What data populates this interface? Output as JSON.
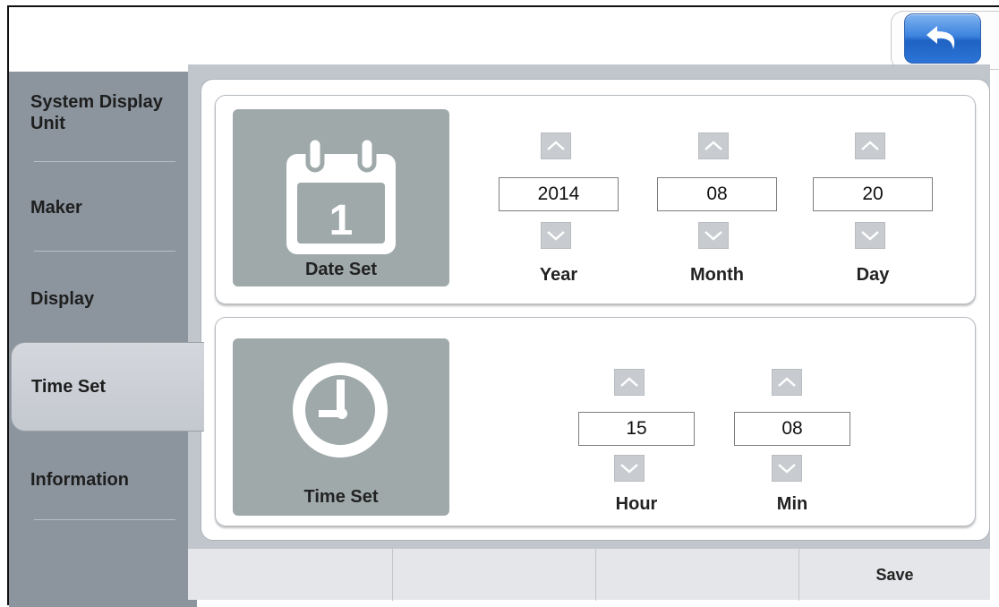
{
  "sidebar": {
    "items": [
      {
        "label": "System Display Unit"
      },
      {
        "label": "Maker"
      },
      {
        "label": "Display"
      },
      {
        "label": "Time Set"
      },
      {
        "label": "Information"
      }
    ]
  },
  "date_set": {
    "label": "Date Set",
    "day_number": "1",
    "year": {
      "label": "Year",
      "value": "2014"
    },
    "month": {
      "label": "Month",
      "value": "08"
    },
    "day": {
      "label": "Day",
      "value": "20"
    }
  },
  "time_set": {
    "label": "Time Set",
    "hour": {
      "label": "Hour",
      "value": "15"
    },
    "min": {
      "label": "Min",
      "value": "08"
    }
  },
  "bottom_bar": {
    "save_label": "Save"
  },
  "colors": {
    "sidebar": "#8c959e",
    "content_bg": "#c1c6cd",
    "icon_box": "#9fa9aa",
    "back_button": "#2b74d6"
  },
  "icons": {
    "back": "back-arrow-icon",
    "calendar": "calendar-icon",
    "clock": "clock-icon",
    "up": "chevron-up-icon",
    "down": "chevron-down-icon"
  }
}
